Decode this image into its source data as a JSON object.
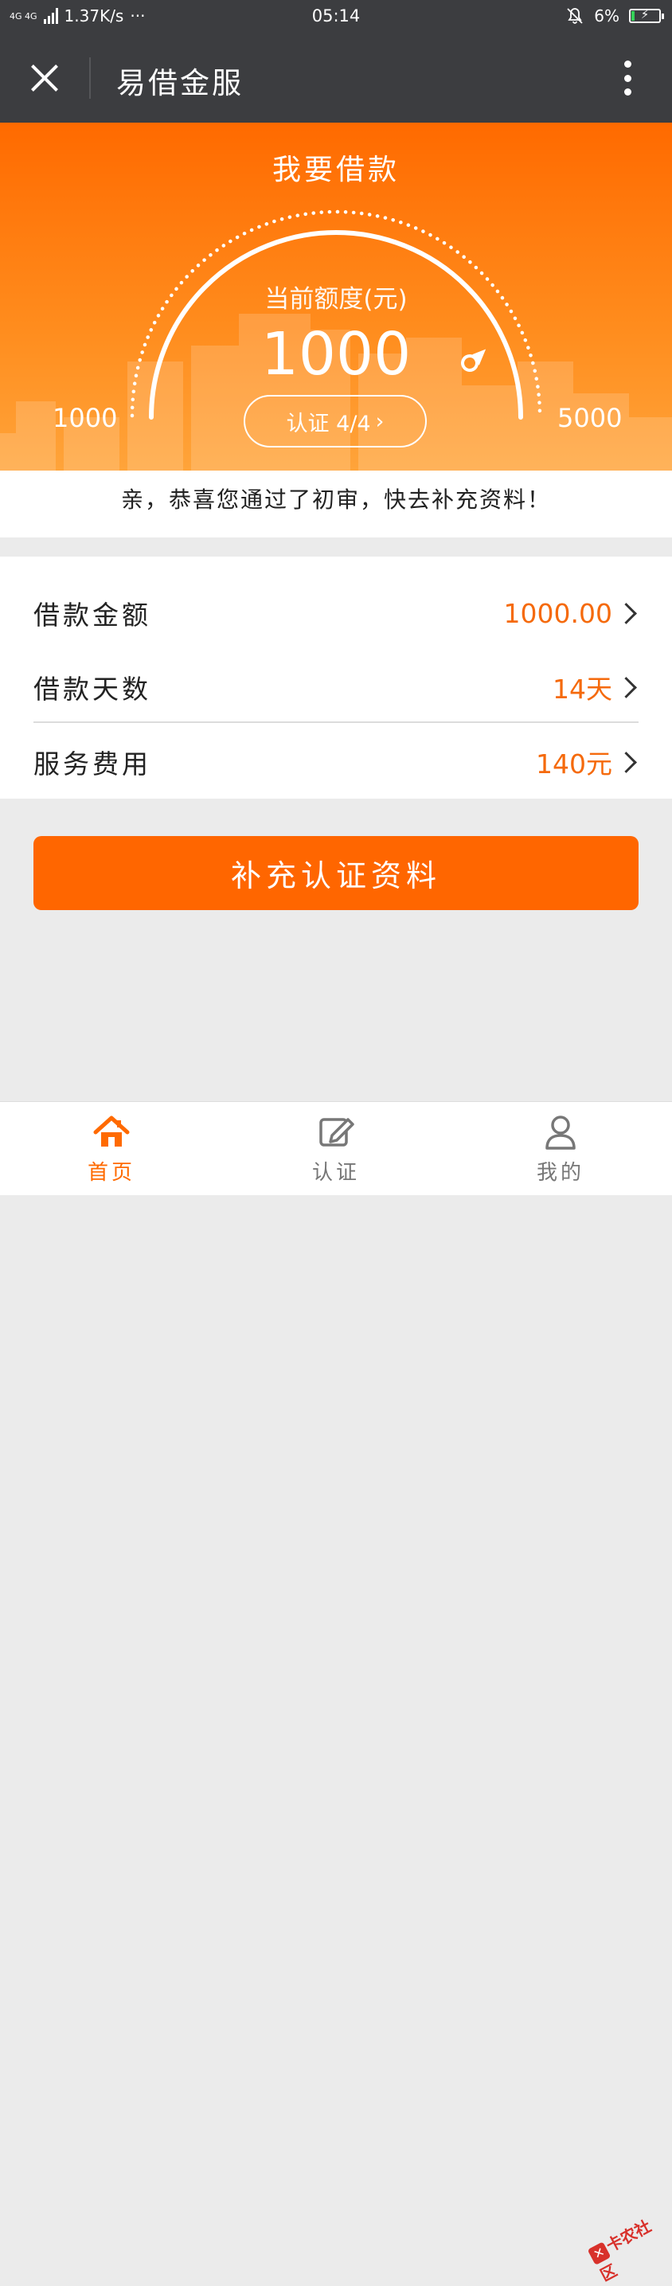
{
  "status_bar": {
    "network": "4G 4G",
    "speed": "1.37K/s",
    "dots": "···",
    "time": "05:14",
    "battery": "6%"
  },
  "header": {
    "title": "易借金服"
  },
  "hero": {
    "title": "我要借款",
    "credit_label": "当前额度(元)",
    "credit_amount": "1000",
    "range_min": "1000",
    "range_max": "5000",
    "auth_button": "认证 4/4",
    "auth_chevron": "›"
  },
  "notice": "亲，恭喜您通过了初审，快去补充资料！",
  "loan": {
    "rows": [
      {
        "label": "借款金额",
        "value": "1000.00"
      },
      {
        "label": "借款天数",
        "value": "14天"
      },
      {
        "label": "服务费用",
        "value": "140元"
      }
    ]
  },
  "submit_button": "补充认证资料",
  "tabs": [
    {
      "label": "首页",
      "icon": "home-icon",
      "active": true
    },
    {
      "label": "认证",
      "icon": "edit-icon",
      "active": false
    },
    {
      "label": "我的",
      "icon": "user-icon",
      "active": false
    }
  ],
  "watermark": "卡农社区",
  "colors": {
    "accent": "#ff6600",
    "header": "#3c3d40",
    "value_text": "#f56a0c"
  }
}
